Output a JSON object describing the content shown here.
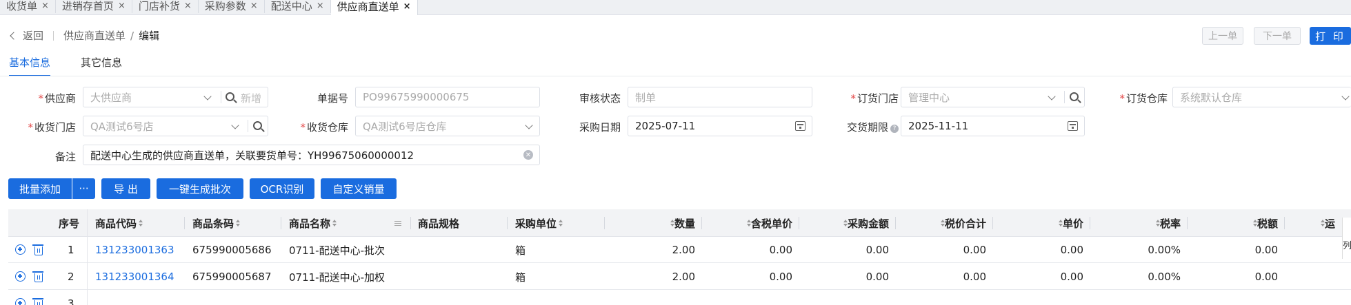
{
  "tabs": [
    {
      "label": "收货单",
      "active": false
    },
    {
      "label": "进销存首页",
      "active": false
    },
    {
      "label": "门店补货",
      "active": false
    },
    {
      "label": "采购参数",
      "active": false
    },
    {
      "label": "配送中心",
      "active": false
    },
    {
      "label": "供应商直送单",
      "active": true
    }
  ],
  "tab_close": "×",
  "header": {
    "back": "返回",
    "crumb1": "供应商直送单",
    "crumb_sep": "/",
    "crumb2": "编辑",
    "prev": "上一单",
    "next": "下一单",
    "print": "打 印"
  },
  "subtabs": [
    "基本信息",
    "其它信息"
  ],
  "form": {
    "supplier": {
      "label": "供应商",
      "placeholder": "大供应商",
      "addnew": "新增"
    },
    "doc_no": {
      "label": "单据号",
      "value": "PO99675990000675"
    },
    "audit": {
      "label": "审核状态",
      "value": "制单"
    },
    "order_store": {
      "label": "订货门店",
      "value": "管理中心"
    },
    "order_wh": {
      "label": "订货仓库",
      "value": "系统默认仓库"
    },
    "recv_store": {
      "label": "收货门店",
      "value": "QA测试6号店"
    },
    "recv_wh": {
      "label": "收货仓库",
      "value": "QA测试6号店仓库"
    },
    "purchase_date": {
      "label": "采购日期",
      "value": "2025-07-11"
    },
    "delivery_date": {
      "label": "交货期限",
      "value": "2025-11-11"
    },
    "remark": {
      "label": "备注",
      "value": "配送中心生成的供应商直送单，关联要货单号：YH99675060000012"
    },
    "required_mark": "*",
    "help_mark": "?"
  },
  "actions": {
    "batch_add": "批量添加",
    "more": "···",
    "export": "导 出",
    "gen_batch": "一键生成批次",
    "ocr": "OCR识别",
    "custom_sales": "自定义销量"
  },
  "table": {
    "headers": [
      "序号",
      "商品代码",
      "商品条码",
      "商品名称",
      "商品规格",
      "采购单位",
      "数量",
      "含税单价",
      "采购金额",
      "税价合计",
      "单价",
      "税率",
      "税额",
      "运"
    ],
    "rows": [
      {
        "seq": "1",
        "code": "131233001363",
        "barcode": "675990005686",
        "name": "0711-配送中心-批次",
        "spec": "",
        "unit": "箱",
        "qty": "2.00",
        "tax_price": "0.00",
        "amount": "0.00",
        "total": "0.00",
        "price": "0.00",
        "rate": "0.00%",
        "tax": "0.00"
      },
      {
        "seq": "2",
        "code": "131233001364",
        "barcode": "675990005687",
        "name": "0711-配送中心-加权",
        "spec": "",
        "unit": "箱",
        "qty": "2.00",
        "tax_price": "0.00",
        "amount": "0.00",
        "total": "0.00",
        "price": "0.00",
        "rate": "0.00%",
        "tax": "0.00"
      },
      {
        "seq": "3"
      }
    ]
  },
  "side_button": "列",
  "colors": {
    "primary": "#1a6cdf",
    "required": "#e34848"
  }
}
